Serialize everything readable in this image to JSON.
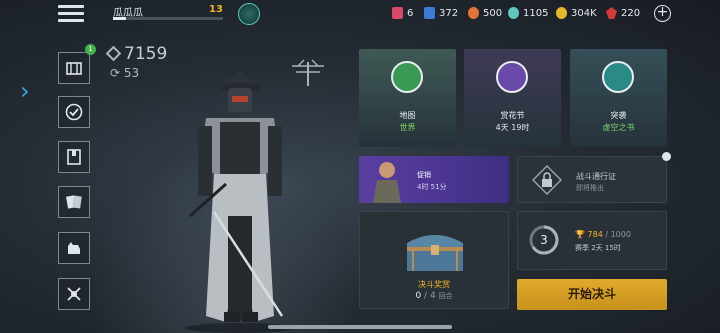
{
  "player": {
    "name": "瓜瓜瓜",
    "level": "13",
    "xp_progress": 0.12
  },
  "resources": [
    {
      "icon": "ticket-icon",
      "value": "6",
      "color": "#d84a68"
    },
    {
      "icon": "energy-cell-icon",
      "value": "372",
      "color": "#3a7bd5"
    },
    {
      "icon": "gear-token-icon",
      "value": "500",
      "color": "#e0753a"
    },
    {
      "icon": "spiral-token-icon",
      "value": "1105",
      "color": "#5fc6bd"
    },
    {
      "icon": "coin-icon",
      "value": "304K",
      "color": "#e8b62a"
    },
    {
      "icon": "ruby-icon",
      "value": "220",
      "color": "#d23a3a"
    }
  ],
  "stats": {
    "power": "7159",
    "rank": "53",
    "badge": "1"
  },
  "tiles": [
    {
      "title": "地图",
      "sub": "世界",
      "sub_color": "#7fd86a",
      "bg": "#3f5a55",
      "icon_bg": "#3a9a55"
    },
    {
      "title": "赏花节",
      "sub": "4天 19时",
      "sub_color": "#e6eaee",
      "bg": "#3e3b55",
      "icon_bg": "#6a4aa8"
    },
    {
      "title": "突袭",
      "sub": "虚空之书",
      "sub_color": "#7fd86a",
      "bg": "#355058",
      "icon_bg": "#2a8a88"
    }
  ],
  "promo": {
    "title": "促销",
    "timer": "4时 51分"
  },
  "battle_pass": {
    "title": "战斗通行证",
    "sub": "即将推出"
  },
  "reward": {
    "title": "决斗奖赏",
    "count": "0",
    "total": "/ 4",
    "suffix": "回合"
  },
  "season": {
    "level": "3",
    "points": "784",
    "points_max": "/ 1000",
    "timer": "赛季 2天 15时"
  },
  "start_button": "开始决斗",
  "colors": {
    "accent": "#f0b528",
    "start": "#d8a226"
  }
}
